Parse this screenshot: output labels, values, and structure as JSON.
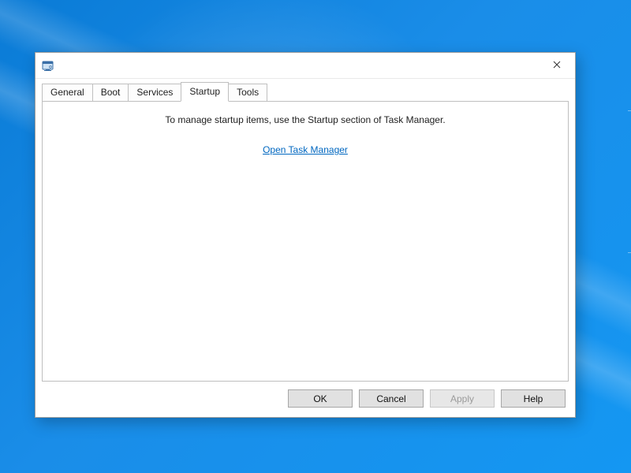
{
  "window": {
    "title": ""
  },
  "tabs": {
    "general": "General",
    "boot": "Boot",
    "services": "Services",
    "startup": "Startup",
    "tools": "Tools",
    "active": "startup"
  },
  "startup_page": {
    "message": "To manage startup items, use the Startup section of Task Manager.",
    "link_label": "Open Task Manager"
  },
  "buttons": {
    "ok": "OK",
    "cancel": "Cancel",
    "apply": "Apply",
    "help": "Help"
  }
}
